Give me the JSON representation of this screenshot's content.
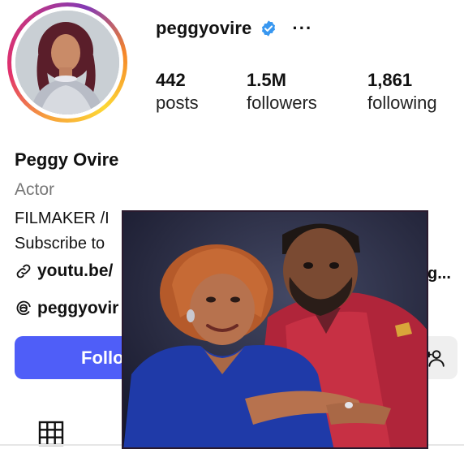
{
  "profile": {
    "username": "peggyovire",
    "display_name": "Peggy Ovire",
    "category": "Actor",
    "bio_line1": "FILMAKER /I",
    "bio_line2": "Subscribe to",
    "link_text": "youtu.be/",
    "link_tail": "g...",
    "threads_text": "peggyovir"
  },
  "stats": [
    {
      "value": "442",
      "label": "posts"
    },
    {
      "value": "1.5M",
      "label": "followers"
    },
    {
      "value": "1,861",
      "label": "following"
    }
  ],
  "actions": {
    "follow_label": "Follo",
    "more_label": "···"
  },
  "colors": {
    "follow_button": "#4f5ef8",
    "verified_badge": "#3897f0"
  },
  "icons": {
    "verified": "verified-badge-icon",
    "more": "more-options-icon",
    "link": "link-icon",
    "threads": "threads-icon",
    "suggest": "add-person-icon",
    "grid": "grid-icon"
  }
}
